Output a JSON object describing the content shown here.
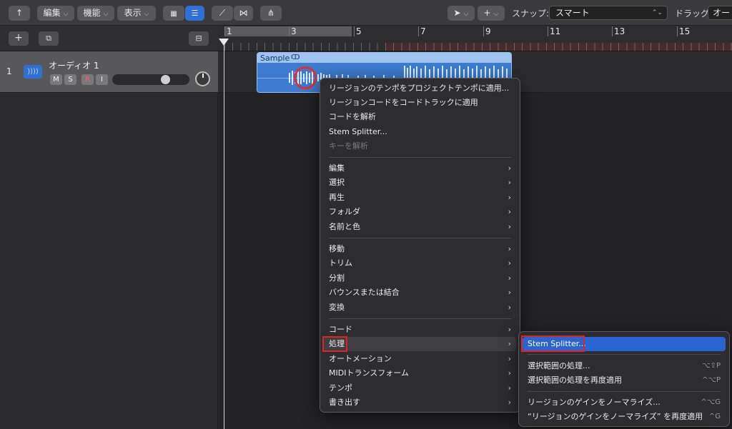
{
  "toolbar": {
    "menus": [
      "編集",
      "機能",
      "表示"
    ],
    "snap_label": "スナップ:",
    "snap_value": "スマート",
    "drag_label": "ドラッグ:",
    "drag_value": "オー"
  },
  "ruler": {
    "bars": [
      "1",
      "3",
      "5",
      "7",
      "9",
      "11",
      "13",
      "15"
    ]
  },
  "track": {
    "number": "1",
    "name": "オーディオ 1",
    "buttons": [
      "M",
      "S",
      "R",
      "I"
    ],
    "fader_level": 0.7
  },
  "region": {
    "name": "Sample"
  },
  "context_menu": {
    "group1": [
      {
        "label": "リージョンのテンポをプロジェクトテンポに適用..."
      },
      {
        "label": "リージョンコードをコードトラックに適用"
      },
      {
        "label": "コードを解析"
      },
      {
        "label": "Stem Splitter..."
      },
      {
        "label": "キーを解析",
        "disabled": true
      }
    ],
    "group2": [
      {
        "label": "編集"
      },
      {
        "label": "選択"
      },
      {
        "label": "再生"
      },
      {
        "label": "フォルダ"
      },
      {
        "label": "名前と色"
      }
    ],
    "group3": [
      {
        "label": "移動"
      },
      {
        "label": "トリム"
      },
      {
        "label": "分割"
      },
      {
        "label": "バウンスまたは結合"
      },
      {
        "label": "変換"
      }
    ],
    "group4": [
      {
        "label": "コード"
      },
      {
        "label": "処理"
      },
      {
        "label": "オートメーション"
      },
      {
        "label": "MIDIトランスフォーム"
      },
      {
        "label": "テンポ"
      },
      {
        "label": "書き出す"
      }
    ]
  },
  "submenu": {
    "items": [
      {
        "label": "Stem Splitter...",
        "shortcut": ""
      },
      {
        "label": "選択範囲の処理...",
        "shortcut": "⌥⇧P"
      },
      {
        "label": "選択範囲の処理を再度適用",
        "shortcut": "^⌥P"
      },
      {
        "label": "リージョンのゲインをノーマライズ...",
        "shortcut": "^⌥G"
      },
      {
        "label": "“リージョンのゲインをノーマライズ” を再度適用",
        "shortcut": "^G"
      }
    ]
  }
}
